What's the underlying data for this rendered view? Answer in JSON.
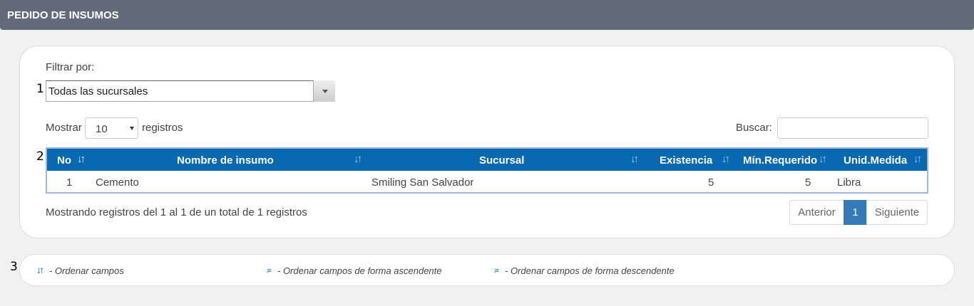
{
  "header": {
    "title": "PEDIDO DE INSUMOS"
  },
  "markers": [
    "1",
    "2",
    "3"
  ],
  "filter": {
    "label": "Filtrar por:",
    "selected": "Todas las sucursales"
  },
  "length": {
    "prefix": "Mostrar",
    "value": "10",
    "suffix": "registros"
  },
  "search": {
    "label": "Buscar:",
    "value": ""
  },
  "table": {
    "columns": [
      "No",
      "Nombre de insumo",
      "Sucursal",
      "Existencia",
      "Mín.Requerido",
      "Unid.Medida"
    ],
    "rows": [
      [
        "1",
        "Cemento",
        "Smiling San Salvador",
        "5",
        "5",
        "Libra"
      ]
    ]
  },
  "info": "Mostrando registros del 1 al 1 de un total de 1 registros",
  "pagination": {
    "prev": "Anterior",
    "current": "1",
    "next": "Siguiente"
  },
  "legend": {
    "items": [
      {
        "icon": "sort-both-icon",
        "text": "- Ordenar campos"
      },
      {
        "icon": "sort-asc-icon",
        "text": "- Ordenar campos de forma ascendente"
      },
      {
        "icon": "sort-desc-icon",
        "text": "- Ordenar campos de forma descendente"
      }
    ]
  },
  "colors": {
    "header": "#636b78",
    "table_header": "#0869b1",
    "active_page": "#337ab7"
  }
}
